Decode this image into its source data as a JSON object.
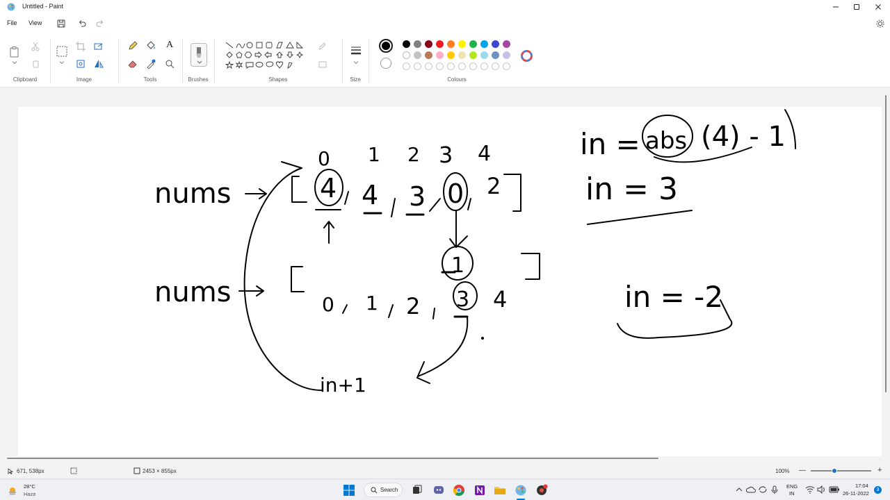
{
  "window": {
    "title": "Untitled - Paint"
  },
  "menu": {
    "file": "File",
    "view": "View"
  },
  "ribbon": {
    "groups": {
      "clipboard": "Clipboard",
      "image": "Image",
      "tools": "Tools",
      "brushes": "Brushes",
      "shapes": "Shapes",
      "size": "Size",
      "colours": "Colours"
    },
    "text_tool": "A",
    "colours_row1": [
      "#000000",
      "#7f7f7f",
      "#880015",
      "#ed1c24",
      "#ff7f27",
      "#fff200",
      "#22b14c",
      "#00a2e8",
      "#3f48cc",
      "#a349a4"
    ],
    "colours_row2": [
      "#ffffff",
      "#c3c3c3",
      "#b97a57",
      "#ffaec9",
      "#ffc90e",
      "#efe4b0",
      "#b5e61d",
      "#99d9ea",
      "#7092be",
      "#c8bfe7"
    ],
    "primary_colour": "#000000",
    "secondary_colour": "#ffffff"
  },
  "status": {
    "cursor_pos": "671, 538px",
    "canvas_size": "2453 × 855px",
    "zoom": "100%",
    "zoom_out": "—",
    "zoom_in": "+"
  },
  "taskbar": {
    "weather_temp": "28°C",
    "weather_desc": "Haze",
    "search_label": "Search",
    "lang_line1": "ENG",
    "lang_line2": "IN",
    "time": "17:04",
    "date": "26-11-2022",
    "notification_count": "3"
  },
  "drawing": {
    "label_nums_1": "nums",
    "label_nums_2": "nums",
    "index_0": "0",
    "index_1": "1",
    "index_2": "2",
    "index_3": "3",
    "index_4": "4",
    "arr1_a": "4",
    "arr1_b": "4",
    "arr1_c": "3",
    "arr1_d": "0",
    "arr1_e": "2",
    "arr2_a": "0",
    "arr2_b": "1",
    "arr2_c": "2",
    "arr2_d": "3",
    "arr2_e": "4",
    "circled_one": "1",
    "in_plus_one": "in+1",
    "eq1_left": "in =",
    "eq1_abs": "abs",
    "eq1_right": "(4) - 1",
    "eq2": "in = 3",
    "eq3": "in = -2"
  }
}
